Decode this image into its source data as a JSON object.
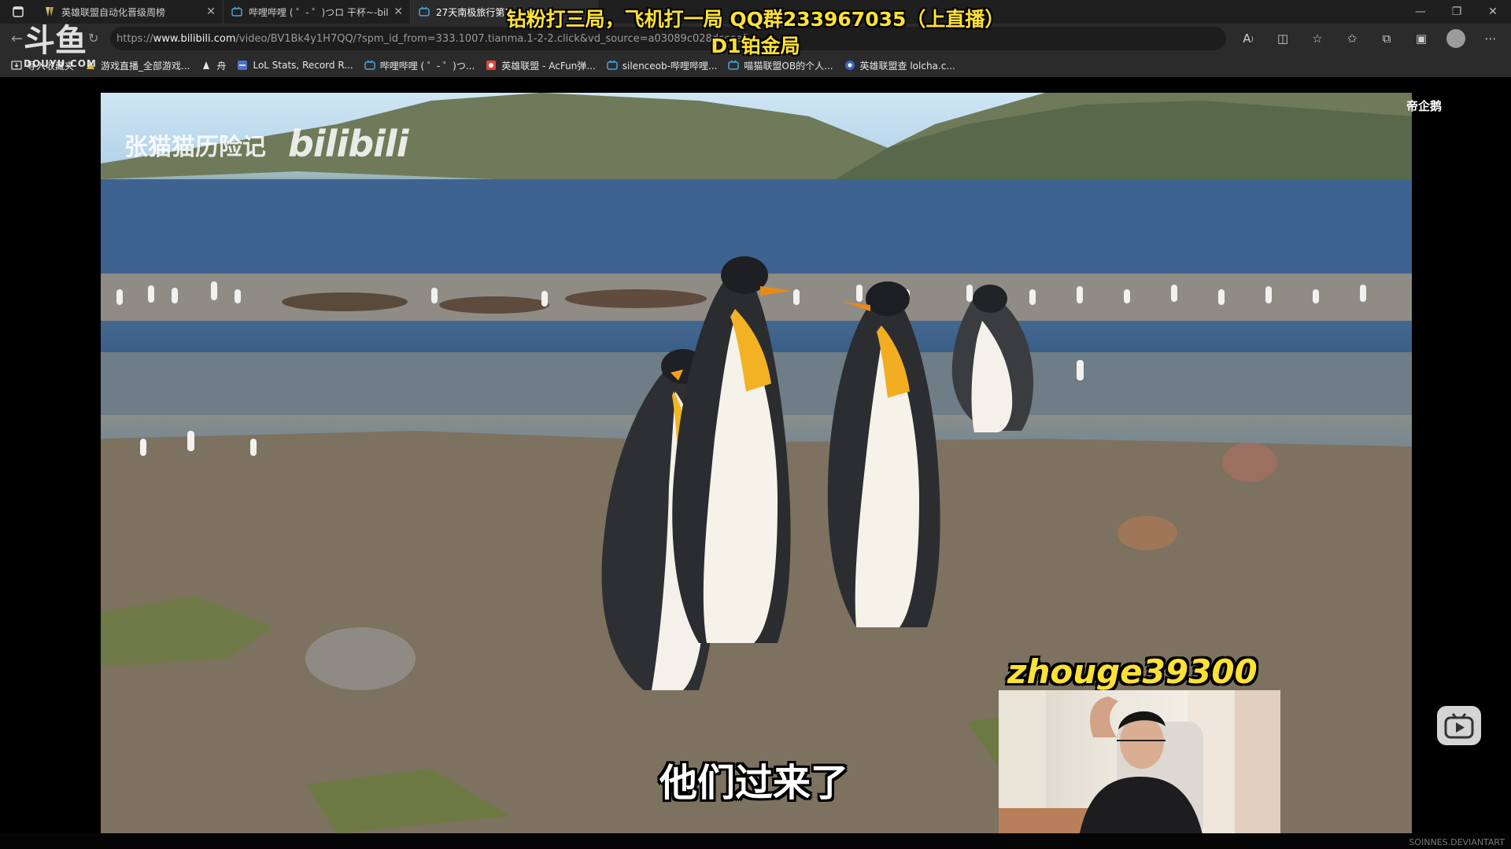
{
  "browser": {
    "tabs": [
      {
        "title": "英雄联盟自动化晋级周榜",
        "active": false
      },
      {
        "title": "哔哩哔哩 ( ゜- ゜)つロ 干杯~-bili",
        "active": false
      },
      {
        "title": "27天南极旅行第1",
        "active": true
      }
    ],
    "url_prefix": "https://",
    "url_domain": "www.bilibili.com",
    "url_path": "/video/BV1Bk4y1H7QQ/?spm_id_from=333.1007.tianma.1-2-2.click&vd_source=a03089c028dccee5",
    "bookmarks": [
      {
        "label": "导入收藏夹",
        "icon": "import-icon"
      },
      {
        "label": "游戏直播_全部游戏...",
        "icon": "game-icon"
      },
      {
        "label": "舟",
        "icon": "boat-icon"
      },
      {
        "label": "LoL Stats, Record R...",
        "icon": "stats-icon"
      },
      {
        "label": "哔哩哔哩 ( ゜- ゜)つ...",
        "icon": "bilibili-tv-icon"
      },
      {
        "label": "英雄联盟 - AcFun弹...",
        "icon": "acfun-icon"
      },
      {
        "label": "silenceob-哔哩哔哩...",
        "icon": "bilibili-tv-icon"
      },
      {
        "label": "喵猫联盟OB的个人...",
        "icon": "bilibili-tv-icon"
      },
      {
        "label": "英雄联盟查 lolcha.c...",
        "icon": "lolcha-icon"
      }
    ]
  },
  "overlay": {
    "logo_big": "斗鱼",
    "logo_small": "DOUYU.COM",
    "title_line1": "钻粉打三局，飞机打一局   QQ群233967035（上直播）",
    "title_line2": "D1铂金局",
    "top_right_label": "帝企鹅",
    "streamer_name": "zhouge39300",
    "corner_mark": "SOINNES.DEVIANTART"
  },
  "video": {
    "watermark_text": "张猫猫历险记",
    "watermark_logo": "bilibili",
    "subtitle": "他们过来了"
  },
  "colors": {
    "title_yellow": "#ffe135",
    "chrome_dark": "#2b2b2b",
    "tab_strip": "#1f1f1f"
  }
}
